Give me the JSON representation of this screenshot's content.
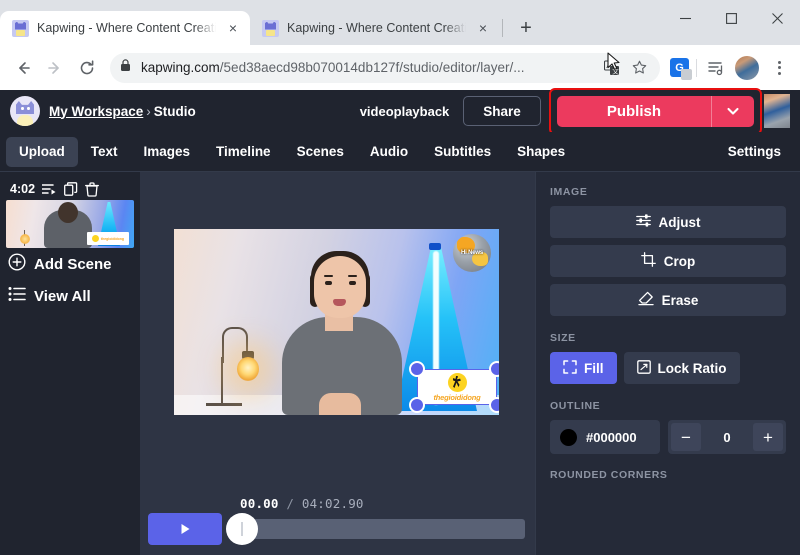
{
  "browser": {
    "tabs": [
      {
        "title": "Kapwing - Where Content Creati",
        "favicon": "kapwing-favicon",
        "active": true,
        "close_label": "×"
      },
      {
        "title": "Kapwing - Where Content Creati",
        "favicon": "kapwing-favicon",
        "active": false,
        "close_label": "×"
      }
    ],
    "new_tab_label": "+",
    "window_controls": {
      "minimize": "minimize-icon",
      "maximize": "maximize-icon",
      "close": "close-icon"
    },
    "toolbar": {
      "back": "back-arrow-icon",
      "forward": "forward-arrow-icon",
      "reload": "reload-icon",
      "lock": "lock-icon",
      "url_host": "kapwing.com",
      "url_path": "/5ed38aecd98b070014db127f/studio/editor/layer/...",
      "url_full": "kapwing.com/5ed38aecd98b070014db127f/studio/editor/layer/...",
      "translate": "translate-icon",
      "bookmark": "star-icon",
      "extension": "google-translate-extension-icon",
      "extension_letter": "G",
      "media": "media-control-icon",
      "profile": "profile-avatar",
      "menu": "three-dot-menu-icon"
    }
  },
  "app": {
    "header": {
      "logo": "workspace-cat-logo",
      "workspace": "My Workspace",
      "separator": "›",
      "section": "Studio",
      "project_name": "videoplayback",
      "share_label": "Share",
      "publish_label": "Publish",
      "publish_caret": "chevron-down-icon",
      "accent_publish": "#ec3a5e",
      "highlight_color": "#e81010"
    },
    "tabs": [
      {
        "label": "Upload",
        "active": true
      },
      {
        "label": "Text",
        "active": false
      },
      {
        "label": "Images",
        "active": false
      },
      {
        "label": "Timeline",
        "active": false
      },
      {
        "label": "Scenes",
        "active": false
      },
      {
        "label": "Audio",
        "active": false
      },
      {
        "label": "Subtitles",
        "active": false
      },
      {
        "label": "Shapes",
        "active": false
      },
      {
        "label": "Settings",
        "active": false
      }
    ],
    "scenes": {
      "duration": "4:02",
      "icons": [
        "scene-list-icon",
        "duplicate-icon",
        "trash-icon"
      ],
      "thumb_label": "scene-thumbnail",
      "add_scene": "Add Scene",
      "view_all": "View All"
    },
    "canvas": {
      "globe_text": "Hi News",
      "watermark_text": "thegioididong",
      "selection_color": "#5b63e8",
      "rotate_icon": "rotate-icon"
    },
    "player": {
      "play_icon": "play-icon",
      "current_time": "00.00",
      "time_separator": "/",
      "total_time": "04:02.90",
      "accent": "#5b63e8"
    },
    "panel": {
      "image_label": "IMAGE",
      "image_actions": [
        {
          "label": "Adjust",
          "icon": "sliders-icon"
        },
        {
          "label": "Crop",
          "icon": "crop-icon"
        },
        {
          "label": "Erase",
          "icon": "eraser-icon"
        }
      ],
      "size_label": "SIZE",
      "size_options": [
        {
          "label": "Fill",
          "icon": "fill-icon",
          "active": true
        },
        {
          "label": "Lock Ratio",
          "icon": "lock-ratio-icon",
          "active": false
        }
      ],
      "outline_label": "OUTLINE",
      "outline_color": "#000000",
      "outline_width": "0",
      "minus_label": "−",
      "plus_label": "+",
      "rounded_corners_label": "ROUNDED CORNERS"
    }
  }
}
